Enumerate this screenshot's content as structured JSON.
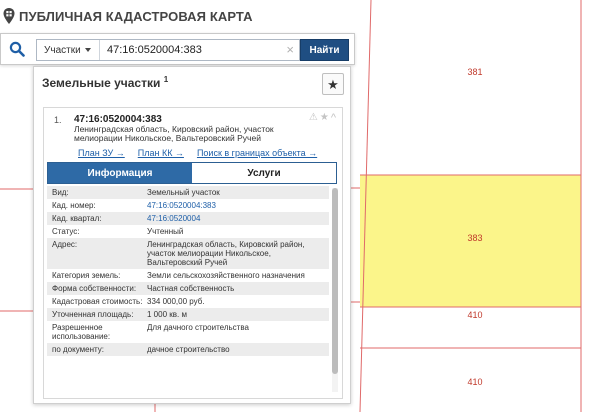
{
  "app": {
    "title": "ПУБЛИЧНАЯ КАДАСТРОВАЯ КАРТА"
  },
  "search": {
    "type_label": "Участки",
    "query": "47:16:0520004:383",
    "clear_glyph": "×",
    "button_label": "Найти"
  },
  "panel": {
    "title": "Земельные участки",
    "count": "1",
    "fav_glyph": "★"
  },
  "item": {
    "number": "1.",
    "cad_number": "47:16:0520004:383",
    "address": "Ленинградская область, Кировский район, участок мелиорации Никольское, Вальтеровский Ручей",
    "icons": {
      "warning": "⚠",
      "star": "★",
      "collapse": "^"
    },
    "links": {
      "plan_zu": "План ЗУ →",
      "plan_kk": "План КК →",
      "search_bounds": "Поиск в границах объекта →"
    },
    "tabs": {
      "info": "Информация",
      "services": "Услуги"
    },
    "properties": [
      {
        "key": "Вид:",
        "value": "Земельный участок",
        "link": false
      },
      {
        "key": "Кад. номер:",
        "value": "47:16:0520004:383",
        "link": true
      },
      {
        "key": "Кад. квартал:",
        "value": "47:16:0520004",
        "link": true
      },
      {
        "key": "Статус:",
        "value": "Учтенный",
        "link": false
      },
      {
        "key": "Адрес:",
        "value": "Ленинградская область, Кировский район, участок мелиорации Никольское, Вальтеровский Ручей",
        "link": false
      },
      {
        "key": "Категория земель:",
        "value": "Земли сельскохозяйственного назначения",
        "link": false
      },
      {
        "key": "Форма собственности:",
        "value": "Частная собственность",
        "link": false
      },
      {
        "key": "Кадастровая стоимость:",
        "value": "334 000,00 руб.",
        "link": false
      },
      {
        "key": "Уточненная площадь:",
        "value": "1 000 кв. м",
        "link": false
      },
      {
        "key": "Разрешенное использование:",
        "value": "Для дачного строительства",
        "link": false
      },
      {
        "key": "по документу:",
        "value": "дачное строительство",
        "link": false
      }
    ]
  },
  "map": {
    "labels": [
      "381",
      "383",
      "410",
      "410"
    ],
    "parcel_border_color": "#e06a6a",
    "selected_fill": "#fbf58a"
  }
}
